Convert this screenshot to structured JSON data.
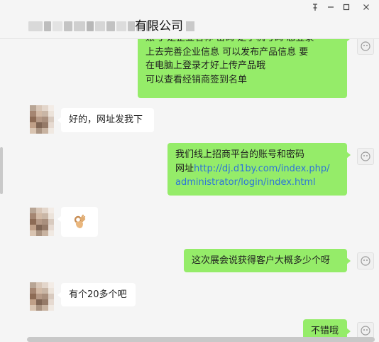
{
  "window": {
    "title": "有限公司",
    "controls": {
      "pin_icon": "pin-icon",
      "minimize_icon": "minimize-icon",
      "maximize_icon": "maximize-icon",
      "close_icon": "close-icon"
    }
  },
  "messages": [
    {
      "direction": "outgoing",
      "lines": [
        "账号 是企业名称 密码 是手机号码 您登录",
        "上去完善企业信息 可以发布产品信息 要",
        "在电脑上登录才好上传产品哦",
        "可以查看经销商签到名单"
      ]
    },
    {
      "direction": "incoming",
      "text": "好的，网址发我下"
    },
    {
      "direction": "outgoing",
      "line1": "我们线上招商平台的账号和密码",
      "line2_prefix": "网址",
      "link_part1": "http://dj.d1by.com/index.php/",
      "link_part2": "administrator/login/index.html"
    },
    {
      "direction": "incoming",
      "emoji": "👌🏼"
    },
    {
      "direction": "outgoing",
      "text": "这次展会说获得客户大概多少个呀"
    },
    {
      "direction": "incoming",
      "text": "有个20多个吧"
    },
    {
      "direction": "outgoing",
      "text": "不错哦"
    }
  ],
  "colors": {
    "outgoing_bubble": "#95ec69",
    "incoming_bubble": "#ffffff",
    "link": "#2d74d9",
    "background": "#f5f5f5"
  }
}
